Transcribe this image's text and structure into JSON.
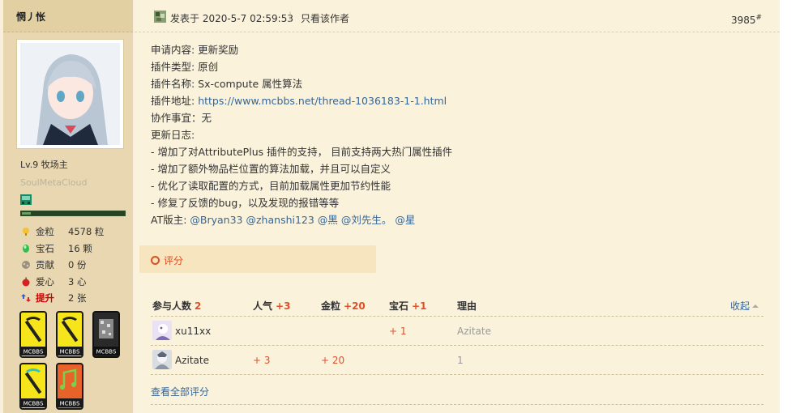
{
  "author": {
    "username": "惘丿怅",
    "level": "Lv.9 牧场主",
    "custom_title": "SoulMetaCloud",
    "exp_fraction": 0.09,
    "stats": [
      {
        "icon": "gold-coin-icon",
        "label": "金粒",
        "value": "4578 粒"
      },
      {
        "icon": "gem-icon",
        "label": "宝石",
        "value": "16 颗"
      },
      {
        "icon": "contribution-icon",
        "label": "贡献",
        "value": "0 份"
      },
      {
        "icon": "apple-heart-icon",
        "label": "爱心",
        "value": "3 心"
      },
      {
        "icon": "promote-icon",
        "label": "提升",
        "value": "2 张"
      }
    ],
    "medals": [
      {
        "icon": "pickaxe-medal-icon",
        "text": "MCBBS",
        "color": "#f5e51a"
      },
      {
        "icon": "pickaxe-medal-icon",
        "text": "MCBBS",
        "color": "#f5e51a"
      },
      {
        "icon": "ore-medal-icon",
        "text": "MCBBS",
        "color": "#2a2a2a"
      },
      {
        "icon": "diamond-pickaxe-medal-icon",
        "text": "MCBBS",
        "color": "#f5e51a"
      },
      {
        "icon": "music-medal-icon",
        "text": "MCBBS",
        "color": "#e8632a"
      }
    ]
  },
  "post": {
    "posted_at": "发表于 2020-5-7 02:59:53",
    "separator": "|",
    "only_author": "只看该作者",
    "floor_number": "3985",
    "floor_mark": "#",
    "lines": {
      "request": "申请内容: 更新奖励",
      "plugin_type": "插件类型: 原创",
      "plugin_name": "插件名称: Sx-compute 属性算法",
      "address_label": "插件地址: ",
      "address_url": "https://www.mcbbs.net/thread-1036183-1-1.html",
      "collab": "协作事宜：无",
      "changelog_title": "更新日志:",
      "changes": [
        "- 增加了对AttributePlus 插件的支持， 目前支持两大热门属性插件",
        "- 增加了额外物品栏位置的算法加载，并且可以自定义",
        "- 优化了读取配置的方式，目前加载属性更加节约性能",
        "- 修复了反馈的bug，以及发现的报错等等"
      ],
      "mods_label": "AT版主: ",
      "mods": [
        "@Bryan33",
        "@zhanshi123",
        "@黑",
        "@刘先生。",
        "@星"
      ]
    },
    "rate_button": "评分",
    "rating": {
      "headers": {
        "participants": "参与人数",
        "participants_count": "2",
        "popularity": "人气",
        "popularity_total": "+3",
        "gold": "金粒",
        "gold_total": "+20",
        "gem": "宝石",
        "gem_total": "+1",
        "reason": "理由",
        "collapse": "收起"
      },
      "rows": [
        {
          "user": "xu11xx",
          "popularity": "",
          "gold": "",
          "gem": "+ 1",
          "reason": "Azitate"
        },
        {
          "user": "Azitate",
          "popularity": "+ 3",
          "gold": "+ 20",
          "gem": "",
          "reason": "1"
        }
      ],
      "view_all": "查看全部评分"
    }
  },
  "colors": {
    "accent_red": "#e0512a",
    "link_blue": "#336699",
    "post_bg": "#fbf2db",
    "sidebar_bg": "#e8d7b0"
  }
}
